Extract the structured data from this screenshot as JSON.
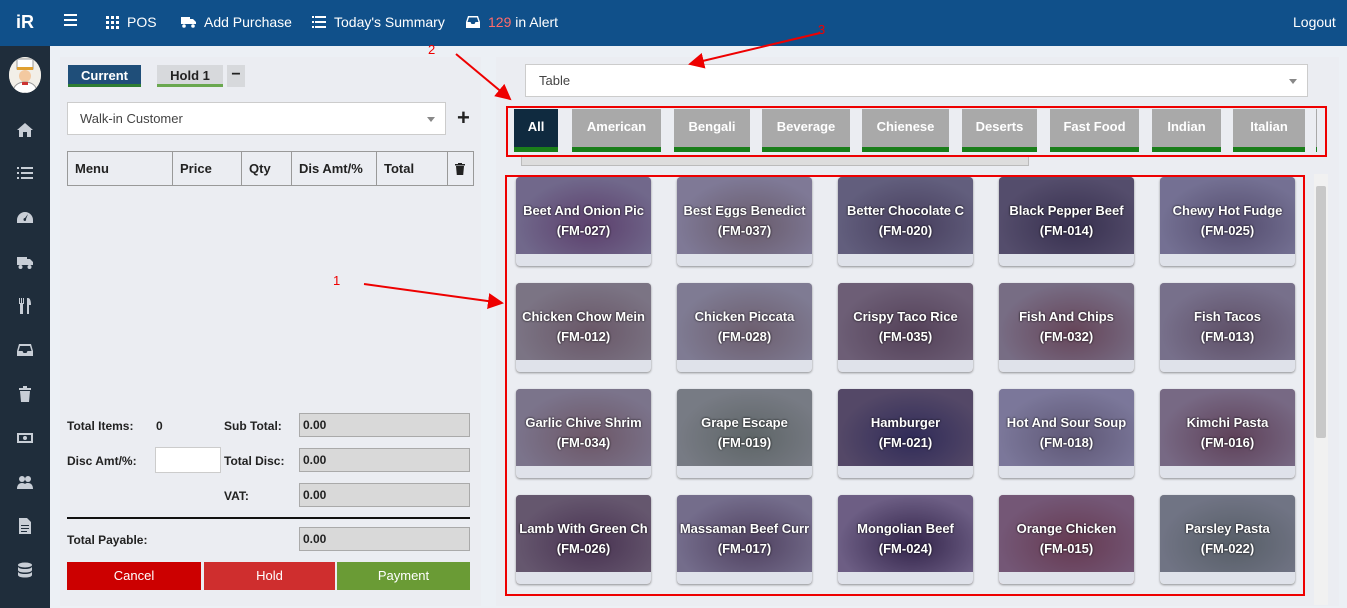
{
  "topbar": {
    "logo": "iR",
    "pos": "POS",
    "add_purchase": "Add Purchase",
    "summary": "Today's Summary",
    "alert_count": "129",
    "alert_label": "in Alert",
    "logout": "Logout"
  },
  "sidebar": {
    "icons": [
      "home-icon",
      "list-icon",
      "dashboard-icon",
      "truck-icon",
      "cutlery-icon",
      "inbox-icon",
      "trash-icon",
      "money-icon",
      "users-icon",
      "document-icon",
      "database-icon"
    ]
  },
  "order": {
    "tab_current": "Current",
    "tab_hold": "Hold 1",
    "tab_minus": "−",
    "customer": "Walk-in Customer",
    "columns": [
      "Menu",
      "Price",
      "Qty",
      "Dis Amt/%",
      "Total"
    ],
    "total_items_label": "Total Items:",
    "total_items": "0",
    "sub_total_label": "Sub Total:",
    "sub_total": "0.00",
    "disc_label": "Disc Amt/%:",
    "total_disc_label": "Total Disc:",
    "total_disc": "0.00",
    "vat_label": "VAT:",
    "vat": "0.00",
    "payable_label": "Total Payable:",
    "payable": "0.00",
    "cancel": "Cancel",
    "hold": "Hold",
    "payment": "Payment"
  },
  "menu_panel": {
    "table_select": "Table",
    "categories": [
      "All",
      "American",
      "Bengali",
      "Beverage",
      "Chienese",
      "Deserts",
      "Fast Food",
      "Indian",
      "Italian"
    ],
    "items": [
      {
        "name": "Beet And Onion Pic",
        "code": "(FM-027)"
      },
      {
        "name": "Best Eggs Benedict",
        "code": "(FM-037)"
      },
      {
        "name": "Better Chocolate C",
        "code": "(FM-020)"
      },
      {
        "name": "Black Pepper Beef",
        "code": "(FM-014)"
      },
      {
        "name": "Chewy Hot Fudge",
        "code": "(FM-025)"
      },
      {
        "name": "Chicken Chow Mein",
        "code": "(FM-012)"
      },
      {
        "name": "Chicken Piccata",
        "code": "(FM-028)"
      },
      {
        "name": "Crispy Taco Rice",
        "code": "(FM-035)"
      },
      {
        "name": "Fish And Chips",
        "code": "(FM-032)"
      },
      {
        "name": "Fish Tacos",
        "code": "(FM-013)"
      },
      {
        "name": "Garlic Chive Shrim",
        "code": "(FM-034)"
      },
      {
        "name": "Grape Escape",
        "code": "(FM-019)"
      },
      {
        "name": "Hamburger",
        "code": "(FM-021)"
      },
      {
        "name": "Hot And Sour Soup",
        "code": "(FM-018)"
      },
      {
        "name": "Kimchi Pasta",
        "code": "(FM-016)"
      },
      {
        "name": "Lamb With Green Ch",
        "code": "(FM-026)"
      },
      {
        "name": "Massaman Beef Curr",
        "code": "(FM-017)"
      },
      {
        "name": "Mongolian Beef",
        "code": "(FM-024)"
      },
      {
        "name": "Orange Chicken",
        "code": "(FM-015)"
      },
      {
        "name": "Parsley Pasta",
        "code": "(FM-022)"
      }
    ]
  },
  "annotations": {
    "one": "1",
    "two": "2",
    "three": "3"
  },
  "colors": {
    "topbar": "#10508a",
    "sidebar": "#1f2d3b",
    "cancel": "#cc0000",
    "hold": "#cf2e2e",
    "payment": "#6a9b35",
    "annotation": "#e00000"
  }
}
